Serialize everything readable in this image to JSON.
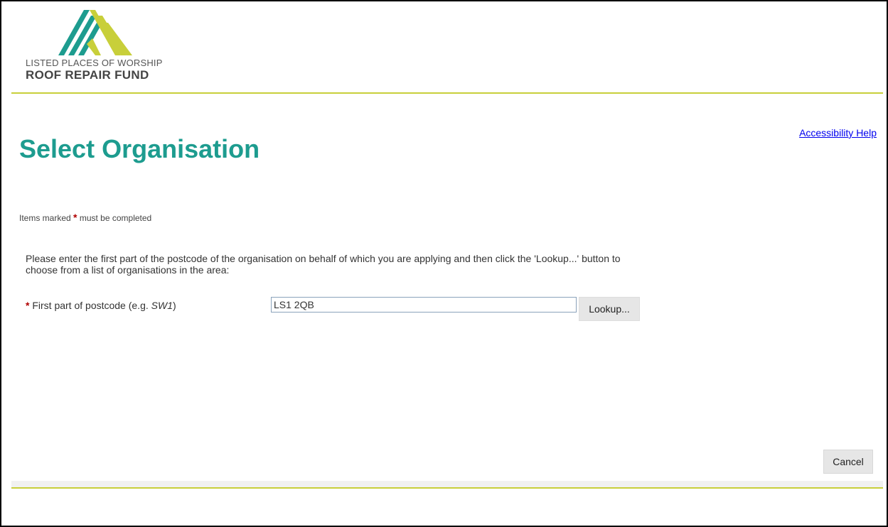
{
  "brand": {
    "line1": "LISTED PLACES OF WORSHIP",
    "line2": "ROOF REPAIR FUND",
    "logo_icon": "roof-chevrons-icon",
    "colors": {
      "teal": "#1d9c8f",
      "lime": "#c8cf3a"
    }
  },
  "header": {
    "accessibility_link": "Accessibility Help"
  },
  "page": {
    "title": "Select Organisation",
    "required_note_before": "Items marked",
    "required_star": "*",
    "required_note_after": "must be completed",
    "instructions": "Please enter the first part of the postcode of the organisation on behalf of which you are applying and then click the 'Lookup...' button to choose from a list of organisations in the area:"
  },
  "form": {
    "postcode": {
      "required_star": "*",
      "label_before": "First part of postcode (e.g. ",
      "label_example": "SW1",
      "label_after": ")",
      "value": "LS1 2QB"
    },
    "lookup_label": "Lookup...",
    "cancel_label": "Cancel"
  }
}
